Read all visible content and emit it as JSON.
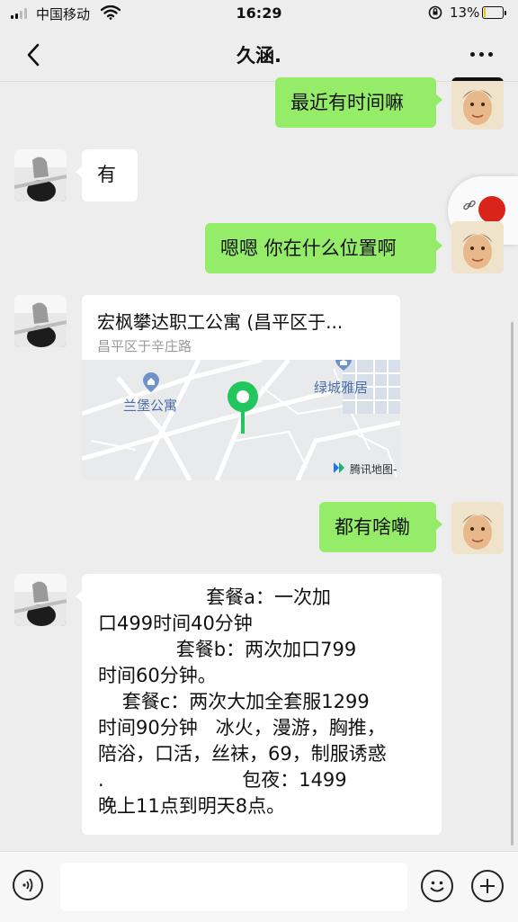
{
  "status_bar": {
    "carrier": "中国移动",
    "time": "16:29",
    "battery": "13%",
    "battery_level": 0.13
  },
  "nav": {
    "title": "久涵.",
    "back_icon": "chevron-left-icon",
    "more_icon": "ellipsis-icon"
  },
  "messages": [
    {
      "from": "me",
      "text": "最近有时间嘛"
    },
    {
      "from": "friend",
      "text": "有"
    },
    {
      "from": "me",
      "text": "嗯嗯 你在什么位置啊"
    },
    {
      "from": "friend",
      "type": "location",
      "name": "宏枫攀达职工公寓 (昌平区于...",
      "address": "昌平区于辛庄路",
      "map_labels": [
        "兰堡公寓",
        "绿城雅居",
        "腾讯地图-"
      ]
    },
    {
      "from": "me",
      "text": "都有啥嘞"
    },
    {
      "from": "friend",
      "type": "text",
      "lines": [
        "                  套餐a：一次加",
        "口499时间40分钟",
        "             套餐b：两次加口799",
        "时间60分钟。",
        "    套餐c：两次大加全套服1299",
        "时间90分钟   冰火，漫游，胸推，",
        "陪浴，口活，丝袜，69，制服诱惑",
        ".                       包夜：1499",
        "晚上11点到明天8点。"
      ]
    }
  ],
  "input_bar": {
    "value": "",
    "voice_icon": "voice-icon",
    "emoji_icon": "emoji-icon",
    "plus_icon": "plus-icon"
  }
}
